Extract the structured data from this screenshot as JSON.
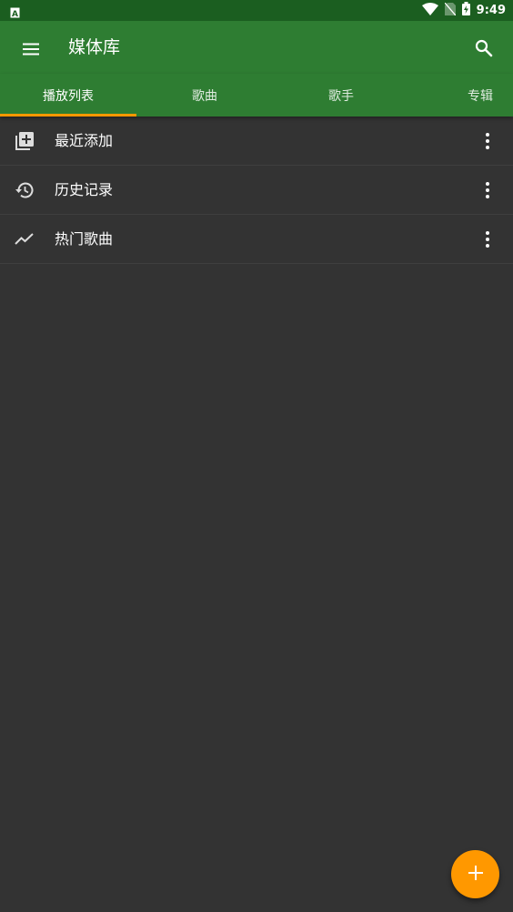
{
  "status_bar": {
    "time": "9:49",
    "icons": [
      "keyboard-a-icon",
      "wifi-icon",
      "no-sim-icon",
      "battery-charging-icon"
    ]
  },
  "app_bar": {
    "title": "媒体库",
    "menu_icon": "menu-icon",
    "search_icon": "search-icon"
  },
  "tabs": [
    {
      "label": "播放列表",
      "active": true
    },
    {
      "label": "歌曲",
      "active": false
    },
    {
      "label": "歌手",
      "active": false
    },
    {
      "label": "专辑",
      "active": false
    }
  ],
  "playlists": [
    {
      "label": "最近添加",
      "icon": "library-add-icon"
    },
    {
      "label": "历史记录",
      "icon": "history-icon"
    },
    {
      "label": "热门歌曲",
      "icon": "trending-icon"
    }
  ],
  "fab": {
    "label": "+",
    "icon": "add-icon"
  },
  "colors": {
    "status_bar": "#1b5e20",
    "primary": "#2e7d32",
    "accent": "#ff9800",
    "background": "#333333",
    "text": "#ffffff"
  }
}
